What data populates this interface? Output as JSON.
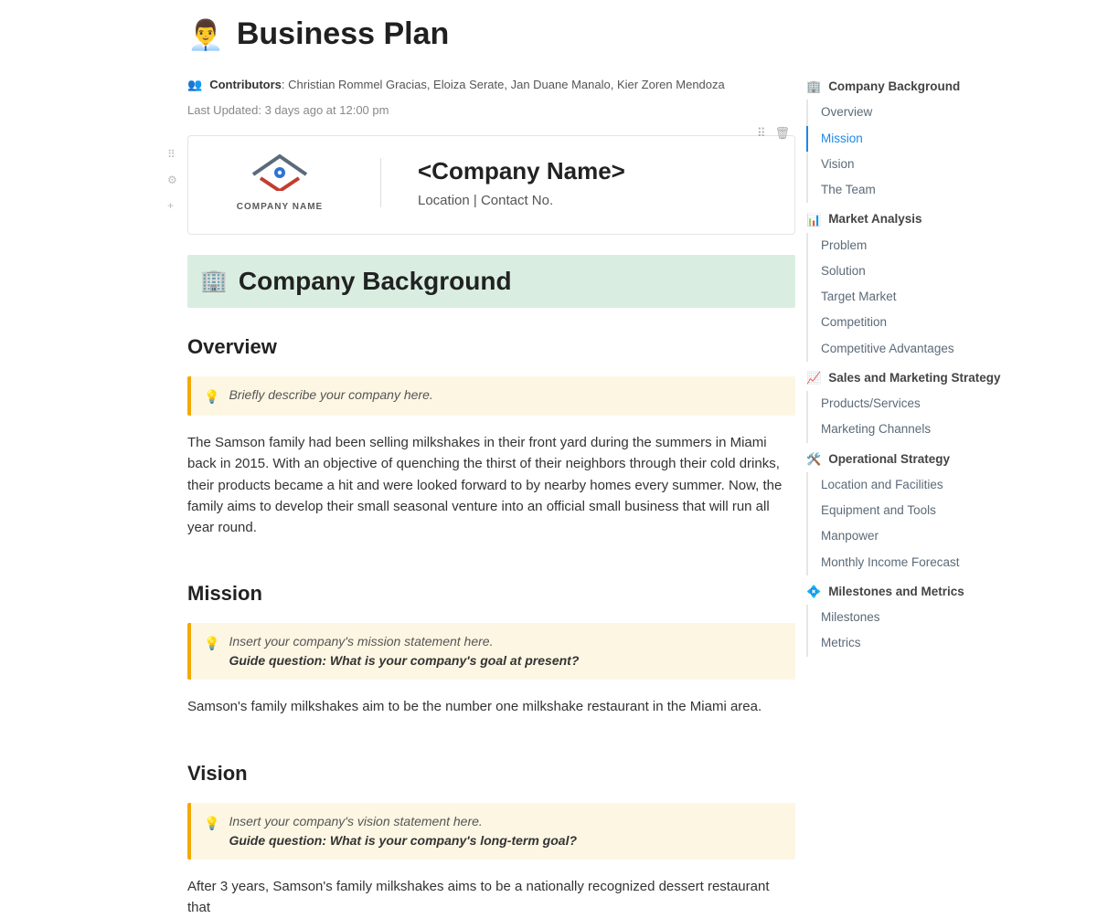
{
  "header": {
    "emoji": "👨‍💼",
    "title": "Business Plan",
    "contributors_label": "Contributors",
    "contributors_names": ": Christian Rommel Gracias, Eloiza Serate, Jan Duane Manalo, Kier Zoren Mendoza",
    "last_updated_label": "Last Updated:",
    "last_updated_value": "3 days ago at 12:00 pm"
  },
  "company_card": {
    "logo_caption": "COMPANY NAME",
    "name": "<Company Name>",
    "sub": "Location | Contact No."
  },
  "section_banner": {
    "emoji": "🏢",
    "title": "Company Background"
  },
  "overview": {
    "heading": "Overview",
    "hint": "Briefly describe your company here.",
    "body": "The Samson family had been selling milkshakes in their front yard during the summers in Miami back in 2015. With an objective of quenching the thirst of their neighbors through their cold drinks, their products became a hit and were looked forward to by nearby homes every summer. Now, the family aims to develop their small seasonal venture into an official small business that will run all year round."
  },
  "mission": {
    "heading": "Mission",
    "hint_line1": "Insert your company's mission statement here.",
    "hint_line2": "Guide question: What is your company's goal at present?",
    "body": "Samson's family milkshakes aim to be the number one milkshake restaurant in the Miami area."
  },
  "vision": {
    "heading": "Vision",
    "hint_line1": "Insert your company's vision statement here.",
    "hint_line2": "Guide question: What is your company's long-term goal?",
    "body": "After 3 years, Samson's family milkshakes aims to be a nationally recognized dessert restaurant that"
  },
  "toc": {
    "s1": {
      "icon": "🏢",
      "title": "Company Background",
      "items": [
        "Overview",
        "Mission",
        "Vision",
        "The Team"
      ]
    },
    "s2": {
      "icon": "📊",
      "title": "Market Analysis",
      "items": [
        "Problem",
        "Solution",
        "Target Market",
        "Competition",
        "Competitive Advantages"
      ]
    },
    "s3": {
      "icon": "📈",
      "title": "Sales and Marketing Strategy",
      "items": [
        "Products/Services",
        "Marketing Channels"
      ]
    },
    "s4": {
      "icon": "🛠️",
      "title": "Operational Strategy",
      "items": [
        "Location and Facilities",
        "Equipment and Tools",
        "Manpower",
        "Monthly Income Forecast"
      ]
    },
    "s5": {
      "icon": "💠",
      "title": "Milestones and Metrics",
      "items": [
        "Milestones",
        "Metrics"
      ]
    }
  }
}
